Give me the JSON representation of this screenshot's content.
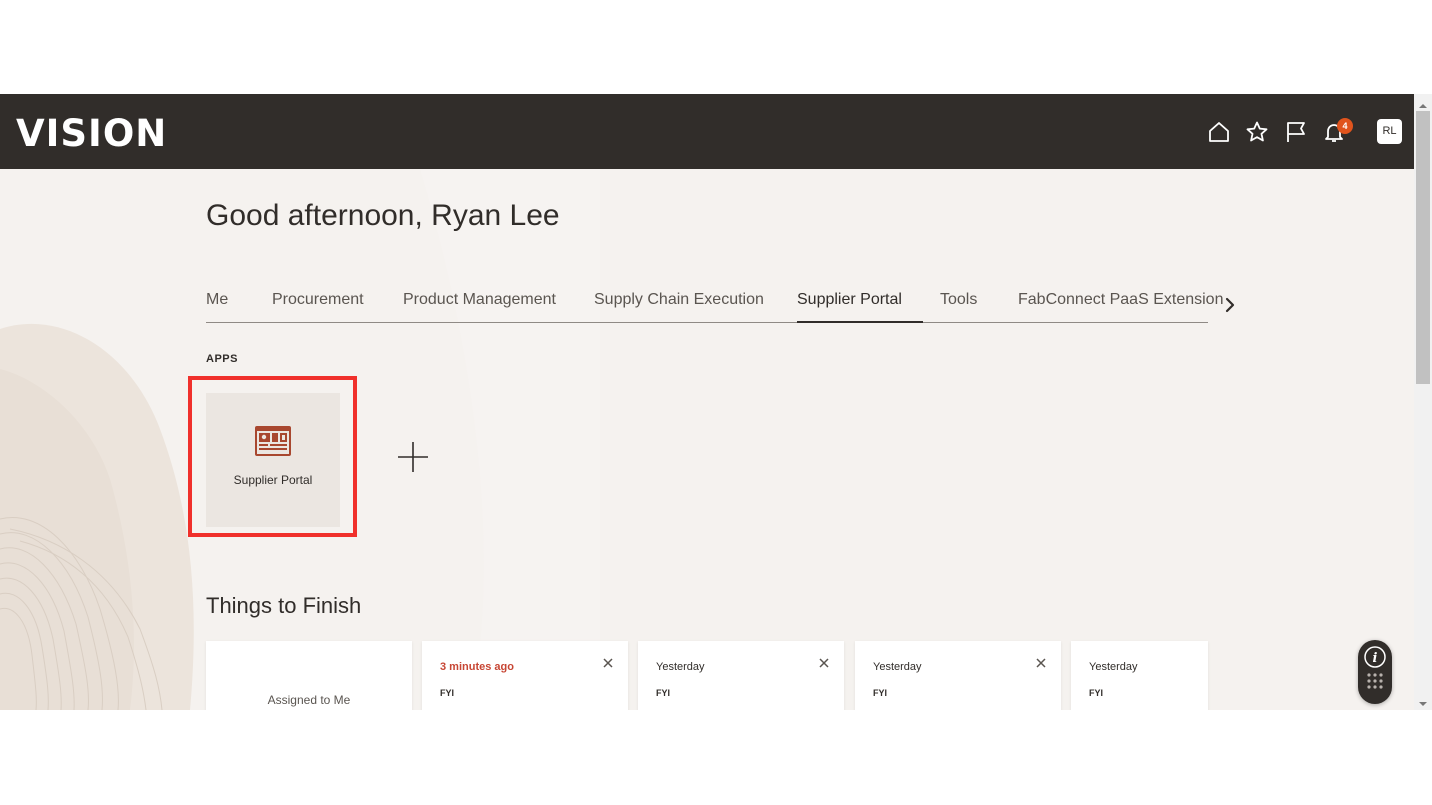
{
  "header": {
    "logo": "VISION",
    "notification_count": "4",
    "avatar_initials": "RL"
  },
  "greeting": "Good afternoon, Ryan Lee",
  "tabs": [
    {
      "label": "Me"
    },
    {
      "label": "Procurement"
    },
    {
      "label": "Product Management"
    },
    {
      "label": "Supply Chain Execution"
    },
    {
      "label": "Supplier Portal",
      "active": true
    },
    {
      "label": "Tools"
    },
    {
      "label": "FabConnect PaaS Extension"
    }
  ],
  "apps": {
    "heading": "APPS",
    "items": [
      {
        "label": "Supplier Portal",
        "icon": "supplier-portal-icon"
      }
    ]
  },
  "things_to_finish": {
    "heading": "Things to Finish",
    "assigned_label": "Assigned to Me",
    "cards": [
      {
        "time": "3 minutes ago",
        "type": "FYI"
      },
      {
        "time": "Yesterday",
        "type": "FYI"
      },
      {
        "time": "Yesterday",
        "type": "FYI"
      },
      {
        "time": "Yesterday",
        "type": "FYI"
      }
    ]
  },
  "colors": {
    "topbar": "#312d2a",
    "background": "#f5f2ef",
    "accent": "#c74634",
    "badge": "#e0541d",
    "highlight": "#f0302b"
  }
}
